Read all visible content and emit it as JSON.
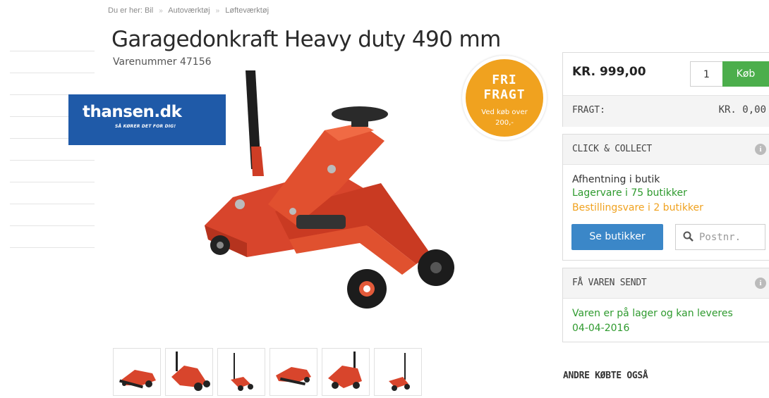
{
  "breadcrumb": {
    "prefix": "Du er her:",
    "items": [
      "Bil",
      "Autoværktøj",
      "Løfteværktøj"
    ]
  },
  "product": {
    "title": "Garagedonkraft Heavy duty 490 mm",
    "sku": "Varenummer 47156",
    "image_icon": "car-jack-image"
  },
  "logo": {
    "text": "thansen.dk",
    "tagline": "SÅ KØRER DET FOR DIG!"
  },
  "badge": {
    "line1": "FRI",
    "line2": "FRAGT",
    "line3": "Ved køb over",
    "line4": "200,-"
  },
  "purchase": {
    "price": "KR. 999,00",
    "quantity": "1",
    "buy_label": "Køb",
    "freight_label": "FRAGT:",
    "freight_value": "KR. 0,00"
  },
  "click_collect": {
    "title": "CLICK & COLLECT",
    "line1": "Afhentning i butik",
    "line2": "Lagervare i 75 butikker",
    "line3": "Bestillingsvare i 2 butikker",
    "button": "Se butikker",
    "postnr_placeholder": "Postnr."
  },
  "shipping": {
    "title": "FÅ VAREN SENDT",
    "line1": "Varen er på lager og kan leveres",
    "line2": "04-04-2016"
  },
  "also_bought": "ANDRE KØBTE OGSÅ",
  "colors": {
    "brand_blue": "#1f5aa8",
    "buy_green": "#4cae4c",
    "stock_green": "#2e9a2e",
    "order_orange": "#f0a21f",
    "button_blue": "#3b87c8",
    "jack_red": "#d8452c"
  }
}
